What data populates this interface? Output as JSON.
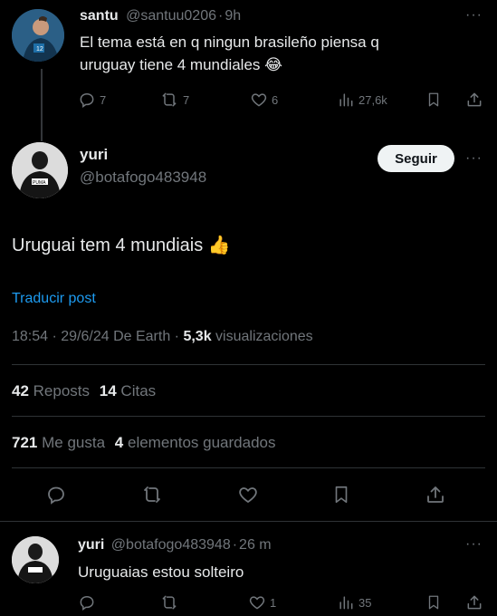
{
  "tweet1": {
    "display_name": "santu",
    "handle": "@santuu0206",
    "dot": "·",
    "time": "9h",
    "text_line1": "El tema está en q ningun brasileño piensa q",
    "text_line2": "uruguay tiene 4 mundiales",
    "emoji": "😂",
    "replies": "7",
    "reposts": "7",
    "likes": "6",
    "views": "27,6k"
  },
  "main": {
    "display_name": "yuri",
    "handle": "@botafogo483948",
    "follow_label": "Seguir",
    "text": "Uruguai tem 4 mundiais",
    "emoji": "👍",
    "translate": "Traducir post",
    "timestamp": "18:54 · 29/6/24 De Earth ·",
    "views_count": "5,3k",
    "views_label": "visualizaciones",
    "reposts_count": "42",
    "reposts_label": "Reposts",
    "quotes_count": "14",
    "quotes_label": "Citas",
    "likes_count": "721",
    "likes_label": "Me gusta",
    "saves_count": "4",
    "saves_label": "elementos guardados"
  },
  "reply": {
    "display_name": "yuri",
    "handle": "@botafogo483948",
    "dot": "·",
    "time": "26 m",
    "text": "Uruguaias estou solteiro",
    "replies": "",
    "reposts": "",
    "likes": "1",
    "views": "35"
  },
  "colors": {
    "background": "#000000",
    "text": "#e7e9ea",
    "muted": "#71767b",
    "link": "#1d9bf0",
    "divider": "#2f3336"
  }
}
